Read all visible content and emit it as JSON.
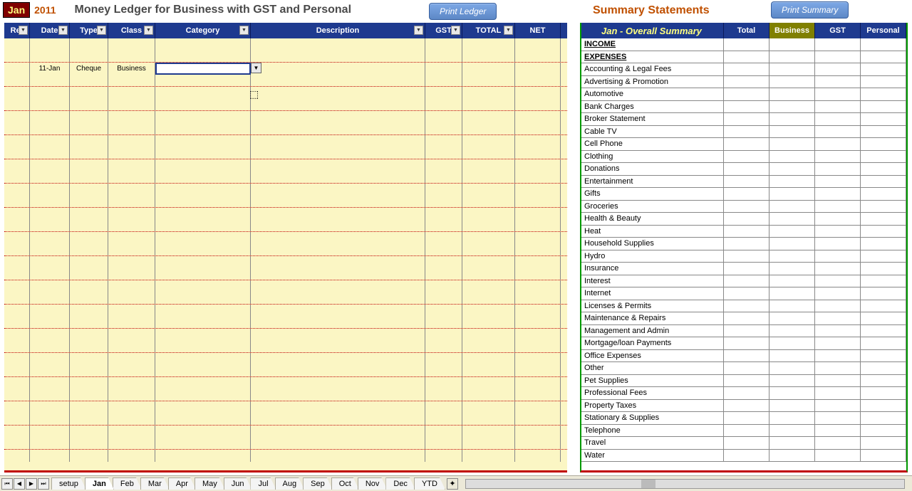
{
  "header": {
    "month": "Jan",
    "year": "2011",
    "ledger_title": "Money Ledger for Business with GST and Personal",
    "summary_title": "Summary Statements",
    "print_ledger": "Print Ledger",
    "print_summary": "Print Summary"
  },
  "ledger_columns": [
    {
      "label": "Ref",
      "w": "w-ref",
      "dd": true
    },
    {
      "label": "Date",
      "w": "w-date",
      "dd": true
    },
    {
      "label": "Type",
      "w": "w-type",
      "dd": true
    },
    {
      "label": "Class",
      "w": "w-class",
      "dd": true
    },
    {
      "label": "Category",
      "w": "w-cat",
      "dd": true
    },
    {
      "label": "Description",
      "w": "w-desc",
      "dd": true
    },
    {
      "label": "GST",
      "w": "w-gst",
      "dd": true
    },
    {
      "label": "TOTAL",
      "w": "w-total",
      "dd": true
    },
    {
      "label": "NET",
      "w": "w-net",
      "dd": false
    }
  ],
  "ledger_entry": {
    "row_index": 2,
    "date": "11-Jan",
    "type": "Cheque",
    "class": "Business",
    "category": "",
    "description": "",
    "gst": "",
    "total": "",
    "net": ""
  },
  "summary_header": {
    "title": "Jan - Overall Summary",
    "cols": [
      {
        "label": "Total",
        "hl": false
      },
      {
        "label": "Business",
        "hl": true
      },
      {
        "label": "GST",
        "hl": false
      },
      {
        "label": "Personal",
        "hl": false
      }
    ]
  },
  "summary_rows": [
    {
      "label": "INCOME",
      "bold": true
    },
    {
      "label": "EXPENSES",
      "bold": true
    },
    {
      "label": "Accounting & Legal Fees"
    },
    {
      "label": "Advertising & Promotion"
    },
    {
      "label": "Automotive"
    },
    {
      "label": "Bank Charges"
    },
    {
      "label": "Broker Statement"
    },
    {
      "label": "Cable TV"
    },
    {
      "label": "Cell Phone"
    },
    {
      "label": "Clothing"
    },
    {
      "label": "Donations"
    },
    {
      "label": "Entertainment"
    },
    {
      "label": "Gifts"
    },
    {
      "label": "Groceries"
    },
    {
      "label": "Health & Beauty"
    },
    {
      "label": "Heat"
    },
    {
      "label": "Household Supplies"
    },
    {
      "label": "Hydro"
    },
    {
      "label": "Insurance"
    },
    {
      "label": "Interest"
    },
    {
      "label": "Internet"
    },
    {
      "label": "Licenses & Permits"
    },
    {
      "label": "Maintenance & Repairs"
    },
    {
      "label": "Management and Admin"
    },
    {
      "label": "Mortgage/loan Payments"
    },
    {
      "label": "Office Expenses"
    },
    {
      "label": "Other"
    },
    {
      "label": "Pet Supplies"
    },
    {
      "label": "Professional Fees"
    },
    {
      "label": "Property Taxes"
    },
    {
      "label": "Stationary & Supplies"
    },
    {
      "label": "Telephone"
    },
    {
      "label": "Travel"
    },
    {
      "label": "Water"
    }
  ],
  "tabs": [
    "setup",
    "Jan",
    "Feb",
    "Mar",
    "Apr",
    "May",
    "Jun",
    "Jul",
    "Aug",
    "Sep",
    "Oct",
    "Nov",
    "Dec",
    "YTD"
  ],
  "active_tab": "Jan",
  "ledger_row_count": 35
}
